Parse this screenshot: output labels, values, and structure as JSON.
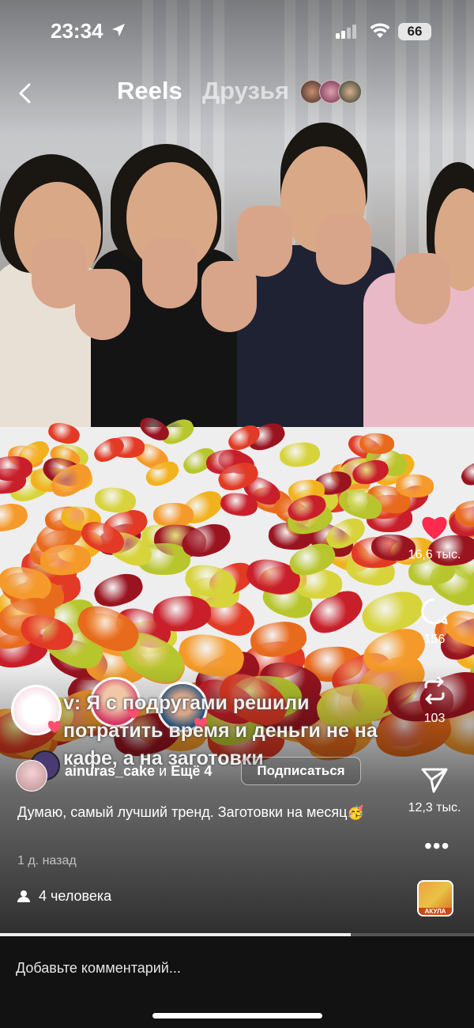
{
  "status_bar": {
    "time": "23:34",
    "battery": "66"
  },
  "nav": {
    "tab_reels": "Reels",
    "tab_friends": "Друзья"
  },
  "video_caption": "v: Я с подругами решили потратить время и деньги не на кафе, а на заготовки",
  "author": {
    "username": "ainuras_cake",
    "connector": "и",
    "more": "Ещё 4",
    "follow_label": "Подписаться"
  },
  "post": {
    "caption": "Думаю, самый лучший тренд. Заготовки на месяц🥳",
    "ago": "1 д. назад",
    "people": "4 человека"
  },
  "actions": {
    "likes": "16,6 тыс.",
    "comments": "156",
    "reposts": "103",
    "shares": "12,3 тыс."
  },
  "audio": {
    "label": "АКУЛА"
  },
  "progress": {
    "fraction": 0.74
  },
  "comment_box": {
    "placeholder": "Добавьте комментарий..."
  },
  "colors": {
    "like": "#ff2b4d",
    "comment_bg": "#121212"
  }
}
